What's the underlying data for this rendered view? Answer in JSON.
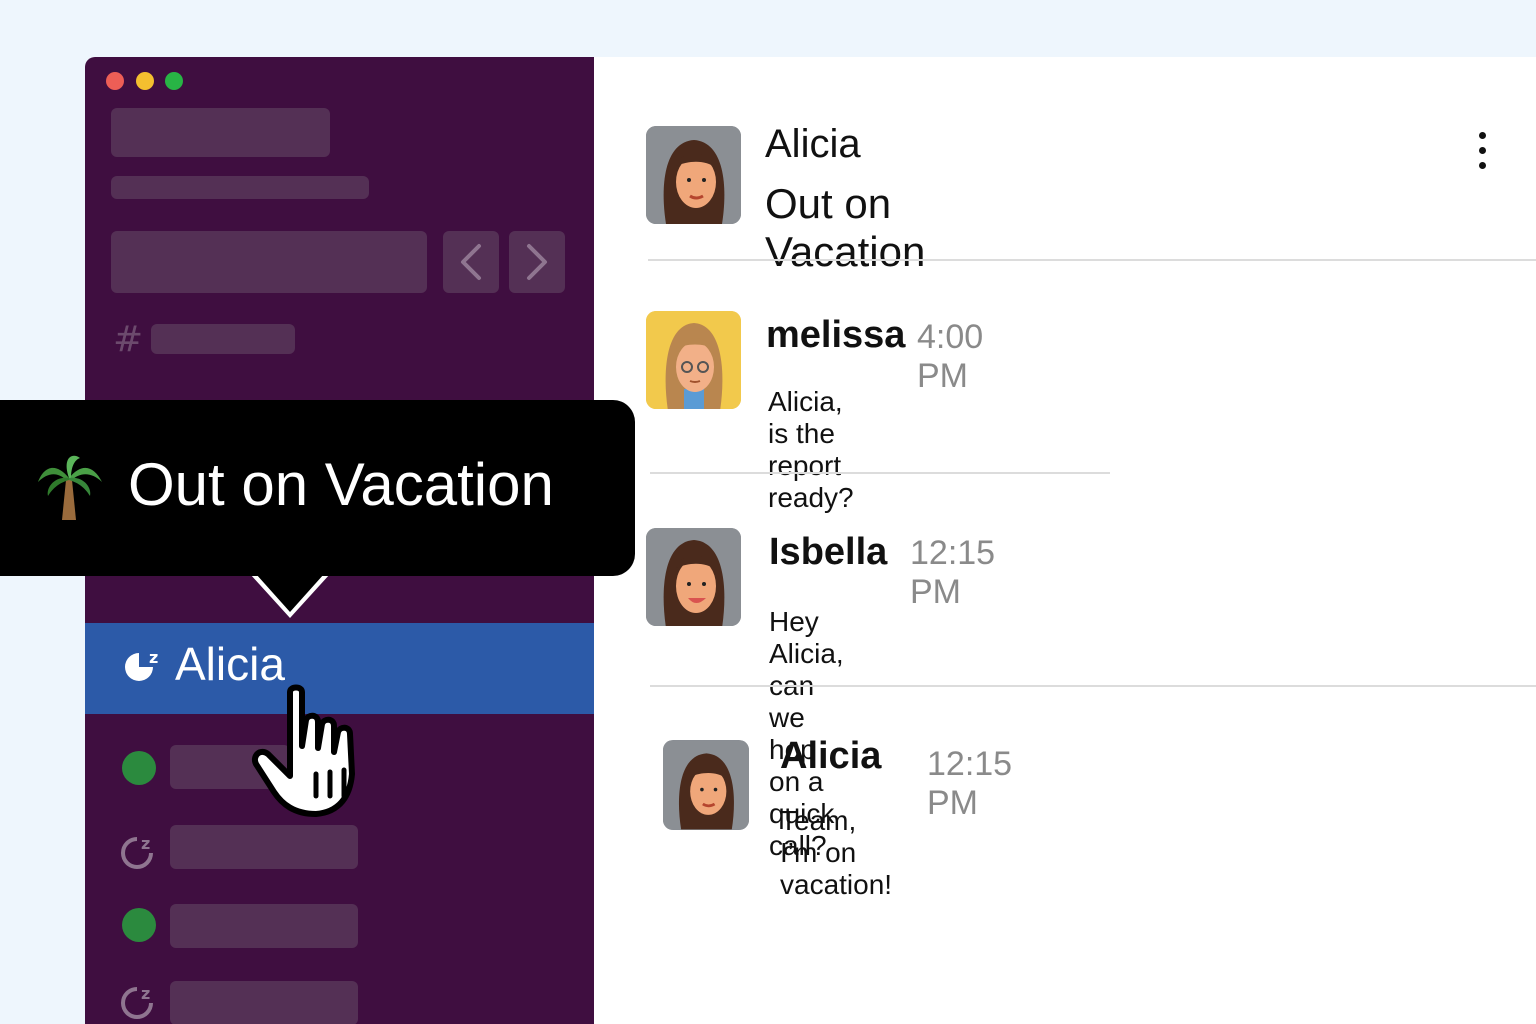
{
  "header": {
    "name": "Alicia",
    "status": "Out on Vacation"
  },
  "tooltip": {
    "emoji_icon": "palm-tree-icon",
    "text": "Out on Vacation"
  },
  "sidebar": {
    "channel_icon": "#",
    "active_user": "Alicia",
    "active_status_icon": "away-snooze-icon",
    "user_rows": [
      {
        "status": "online"
      },
      {
        "status": "away"
      },
      {
        "status": "online"
      },
      {
        "status": "away"
      }
    ]
  },
  "messages": [
    {
      "author": "melissa",
      "time": "4:00 PM",
      "text": "Alicia, is the report ready?"
    },
    {
      "author": "Isbella",
      "time": "12:15 PM",
      "text": "Hey Alicia, can we hop on a quick call?"
    },
    {
      "author": "Alicia",
      "time": "12:15 PM",
      "text": "Team, I’m on vacation!"
    }
  ],
  "colors": {
    "sidebar_bg": "#3f0e40",
    "active_row": "#2c5aa8",
    "online": "#2b8a3e",
    "tooltip_bg": "#000000"
  }
}
